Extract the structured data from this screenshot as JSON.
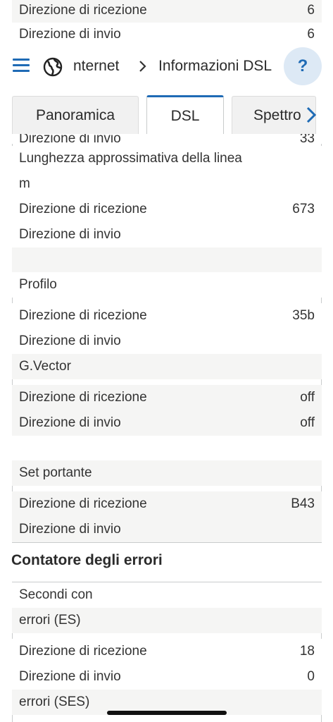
{
  "top_rows": [
    {
      "label": "Direzione di ricezione",
      "value": "6"
    },
    {
      "label": "Direzione di invio",
      "value": "6"
    }
  ],
  "header": {
    "crumb_1": "nternet",
    "crumb_2": "Informazioni DSL",
    "help": "?"
  },
  "tabs": [
    {
      "label": "Panoramica"
    },
    {
      "label": "DSL"
    },
    {
      "label": "Spettro"
    }
  ],
  "dsl": {
    "partial_row": {
      "label": "Direzione di invio",
      "value": "33"
    },
    "length": {
      "title": "Lunghezza approssimativa della linea",
      "unit": "m",
      "rx_label": "Direzione di ricezione",
      "rx_value": "673",
      "tx_label": "Direzione di invio",
      "tx_value": ""
    },
    "profile": {
      "title": "Profilo",
      "rx_label": "Direzione di ricezione",
      "rx_value": "35b",
      "tx_label": "Direzione di invio",
      "tx_value": ""
    },
    "gvector": {
      "title": "G.Vector",
      "rx_label": "Direzione di ricezione",
      "rx_value": "off",
      "tx_label": "Direzione di invio",
      "tx_value": "off"
    },
    "carrier": {
      "title": "Set portante",
      "rx_label": "Direzione di ricezione",
      "rx_value": "B43",
      "tx_label": "Direzione di invio",
      "tx_value": ""
    }
  },
  "errors": {
    "section_title": "Contatore degli errori",
    "es_title_1": "Secondi con",
    "es_title_2": "errori (ES)",
    "rx_label": "Direzione di ricezione",
    "rx_value": "18",
    "tx_label": "Direzione di invio",
    "tx_value": "0",
    "ses_title": "errori (SES)"
  },
  "colors": {
    "accent": "#1f6bb5",
    "shade": "#f5f5f4",
    "border": "#c9cbcc"
  },
  "icons": {
    "menu": "hamburger-icon",
    "globe": "globe-icon",
    "chevron": "chevron-right-icon",
    "help": "help-icon",
    "tab_next": "chevron-right-icon"
  }
}
